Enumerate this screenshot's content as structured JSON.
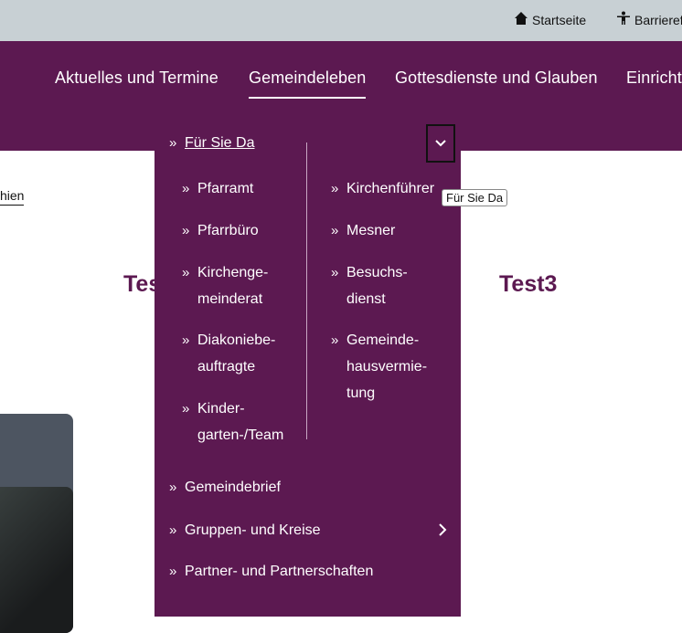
{
  "topbar": {
    "home_label": "Startseite",
    "home_icon": "home-icon",
    "accessibility_label": "Barrieref",
    "accessibility_icon": "accessibility-icon"
  },
  "nav": {
    "items": [
      {
        "label": "Aktuelles und Termine"
      },
      {
        "label": "Gemeindeleben"
      },
      {
        "label": "Gottesdienste und Glauben"
      },
      {
        "label": "Einricht"
      }
    ]
  },
  "background": {
    "link_text": "hien",
    "heading_left": "Tes",
    "heading_right": "Test3"
  },
  "dropdown": {
    "header": "Für Sie Da",
    "col1": [
      "Pfarramt",
      "Pfarrbüro",
      "Kirchenge-\nmeinderat",
      "Diakoniebe-\nauftragte",
      "Kinder-\ngarten-/Team"
    ],
    "col2": [
      "Kirchenführer",
      "Mesner",
      "Besuchs-\ndienst",
      "Gemeinde-\nhausvermie-\ntung"
    ],
    "bottom": [
      "Gemeindebrief",
      "Gruppen- und Kreise",
      "Partner- und Partnerschaften"
    ],
    "tooltip": "Für Sie Da"
  },
  "colors": {
    "brand": "#5c1951",
    "topbar_bg": "#c8d0d4"
  }
}
